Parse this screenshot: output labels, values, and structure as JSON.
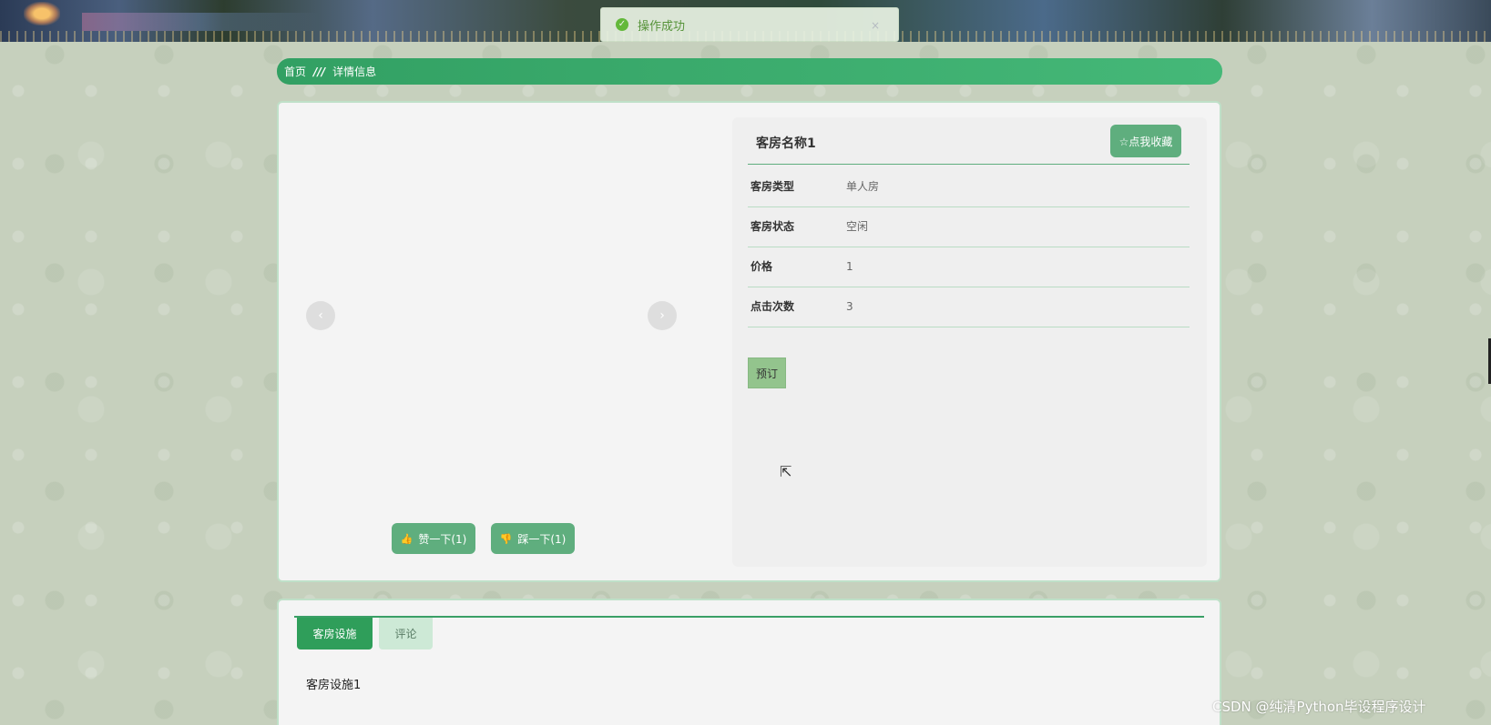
{
  "toast": {
    "message": "操作成功",
    "close_icon": "×"
  },
  "breadcrumb": {
    "home": "首页",
    "separator": "///",
    "current": "详情信息"
  },
  "carousel": {
    "prev_icon": "‹",
    "next_icon": "›"
  },
  "votes": {
    "up_icon": "👍",
    "up_label": "赞一下(1)",
    "down_icon": "👎",
    "down_label": "踩一下(1)"
  },
  "room": {
    "title": "客房名称1",
    "favorite_label": "☆点我收藏",
    "fields": [
      {
        "label": "客房类型",
        "value": "单人房"
      },
      {
        "label": "客房状态",
        "value": "空闲"
      },
      {
        "label": "价格",
        "value": "1"
      },
      {
        "label": "点击次数",
        "value": "3"
      }
    ],
    "book_label": "预订"
  },
  "tabs": {
    "items": [
      {
        "label": "客房设施",
        "active": true
      },
      {
        "label": "评论",
        "active": false
      }
    ],
    "content": "客房设施1"
  },
  "watermark": "CSDN @纯清Python毕设程序设计",
  "colors": {
    "primary": "#2f9e5a",
    "button": "#5fae7e",
    "book": "#93c48d"
  }
}
